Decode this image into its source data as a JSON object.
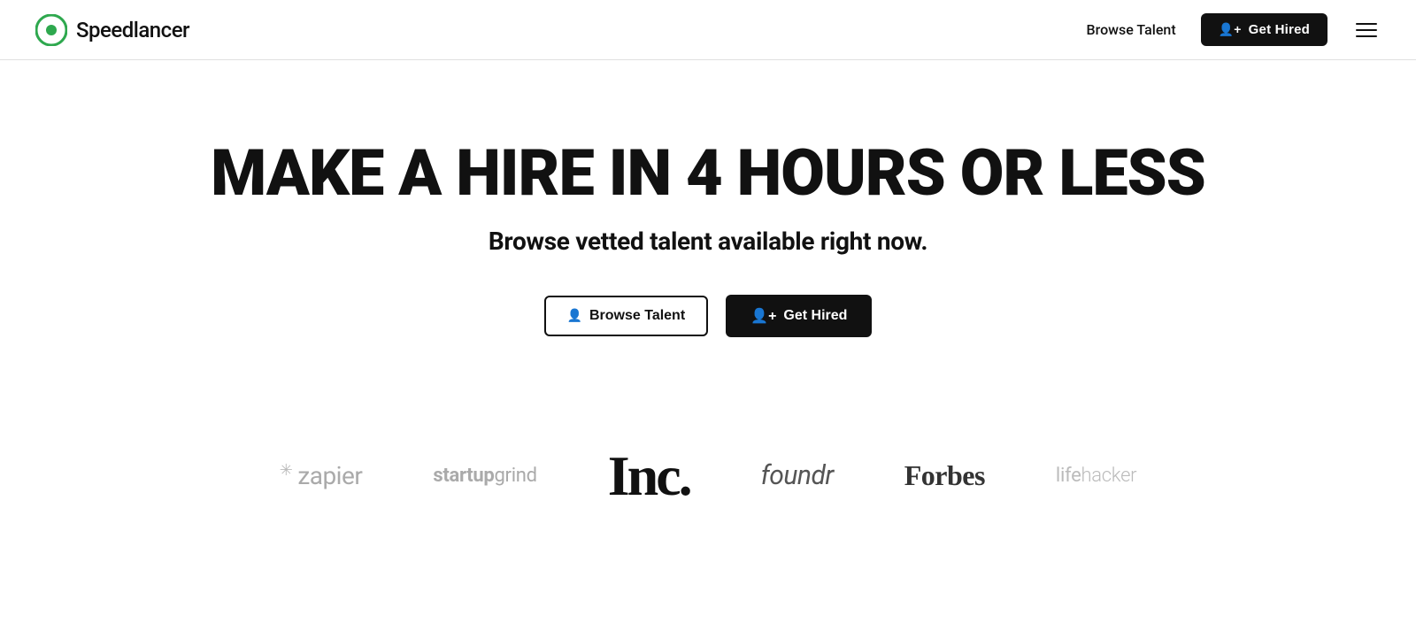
{
  "navbar": {
    "logo_text": "Speedlancer",
    "browse_talent_label": "Browse Talent",
    "get_hired_label": "Get Hired"
  },
  "hero": {
    "title": "MAKE A HIRE IN 4 HOURS OR LESS",
    "subtitle": "Browse vetted talent available right now.",
    "browse_talent_label": "Browse Talent",
    "get_hired_label": "Get Hired"
  },
  "logos": [
    {
      "name": "zapier",
      "text": "zapier",
      "type": "zapier"
    },
    {
      "name": "startupgrind",
      "text": "startupgrind",
      "type": "startupgrind"
    },
    {
      "name": "inc",
      "text": "Inc.",
      "type": "inc"
    },
    {
      "name": "foundr",
      "text": "foundr",
      "type": "foundr"
    },
    {
      "name": "forbes",
      "text": "Forbes",
      "type": "forbes"
    },
    {
      "name": "lifehacker",
      "text": "lifehacker",
      "type": "lifehacker"
    }
  ],
  "colors": {
    "green": "#2ea84e",
    "dark": "#111111",
    "white": "#ffffff"
  }
}
